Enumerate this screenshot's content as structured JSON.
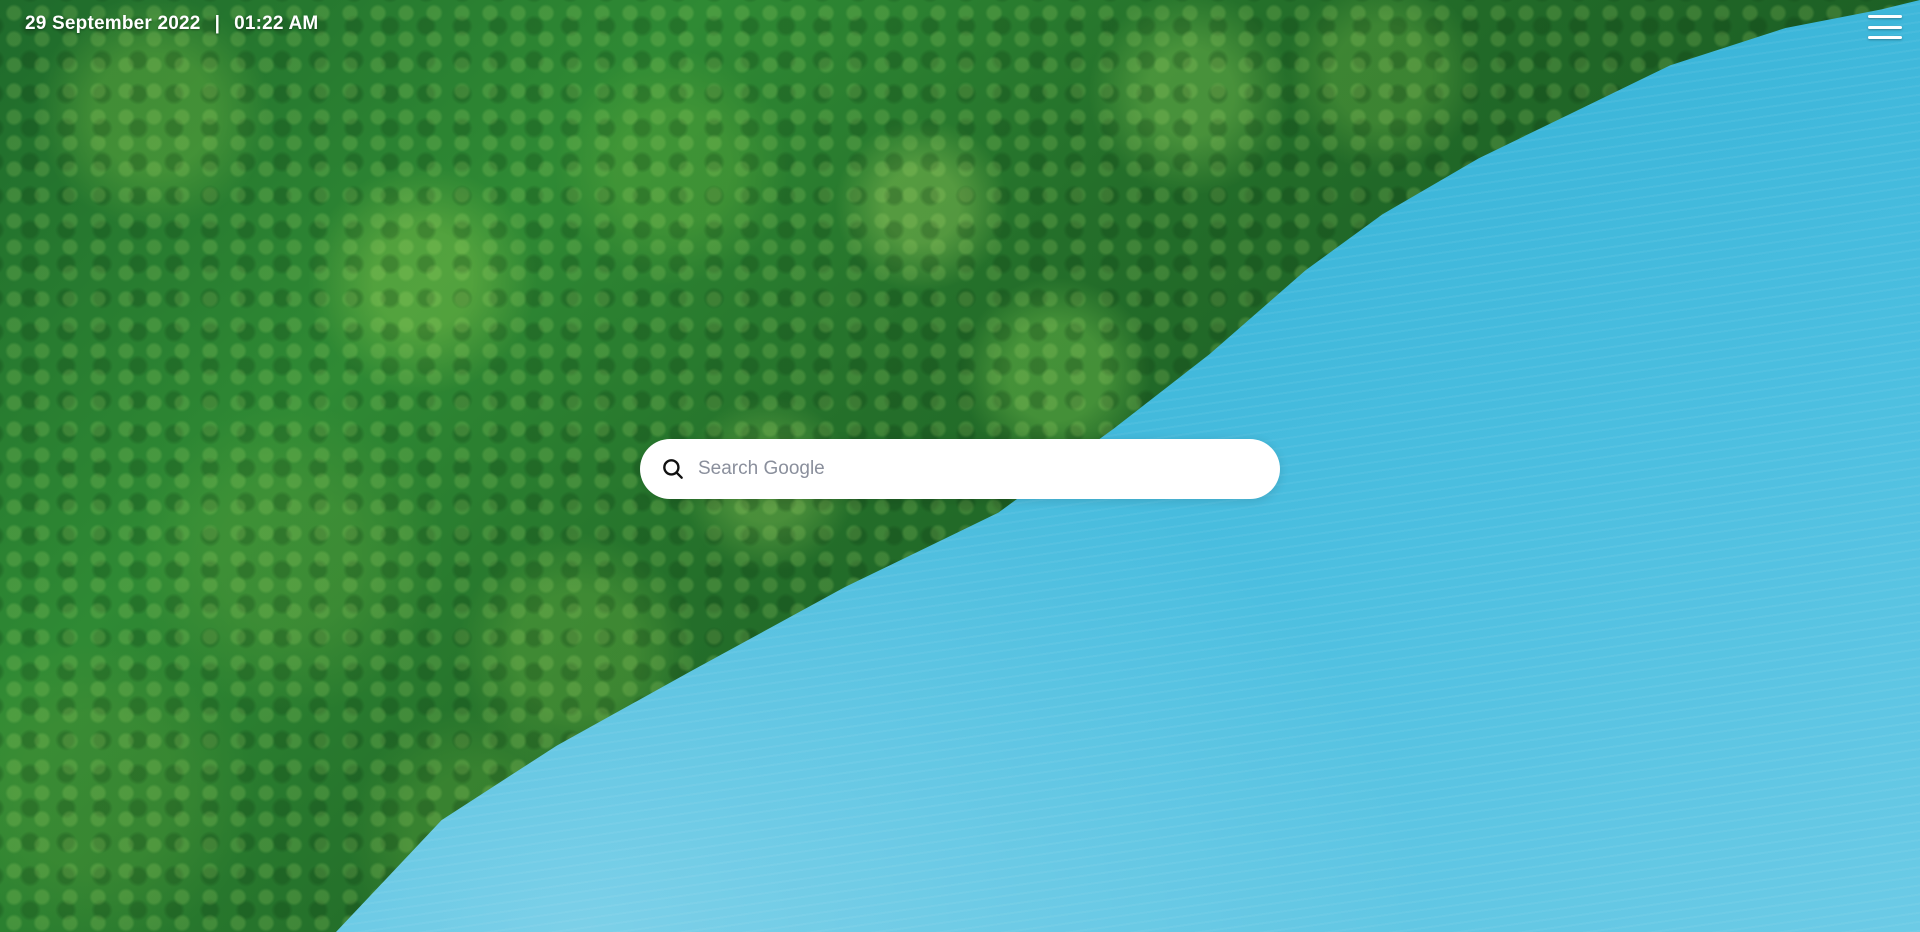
{
  "header": {
    "date": "29 September 2022",
    "separator": "|",
    "time": "01:22 AM"
  },
  "menu": {
    "icon": "hamburger-menu-icon"
  },
  "search": {
    "placeholder": "Search Google",
    "value": "",
    "icon": "search-icon"
  },
  "background": {
    "scene": "aerial forest and turquoise lake",
    "colors": {
      "forest": "#1f6a2b",
      "lake": "#38b4d8"
    }
  }
}
